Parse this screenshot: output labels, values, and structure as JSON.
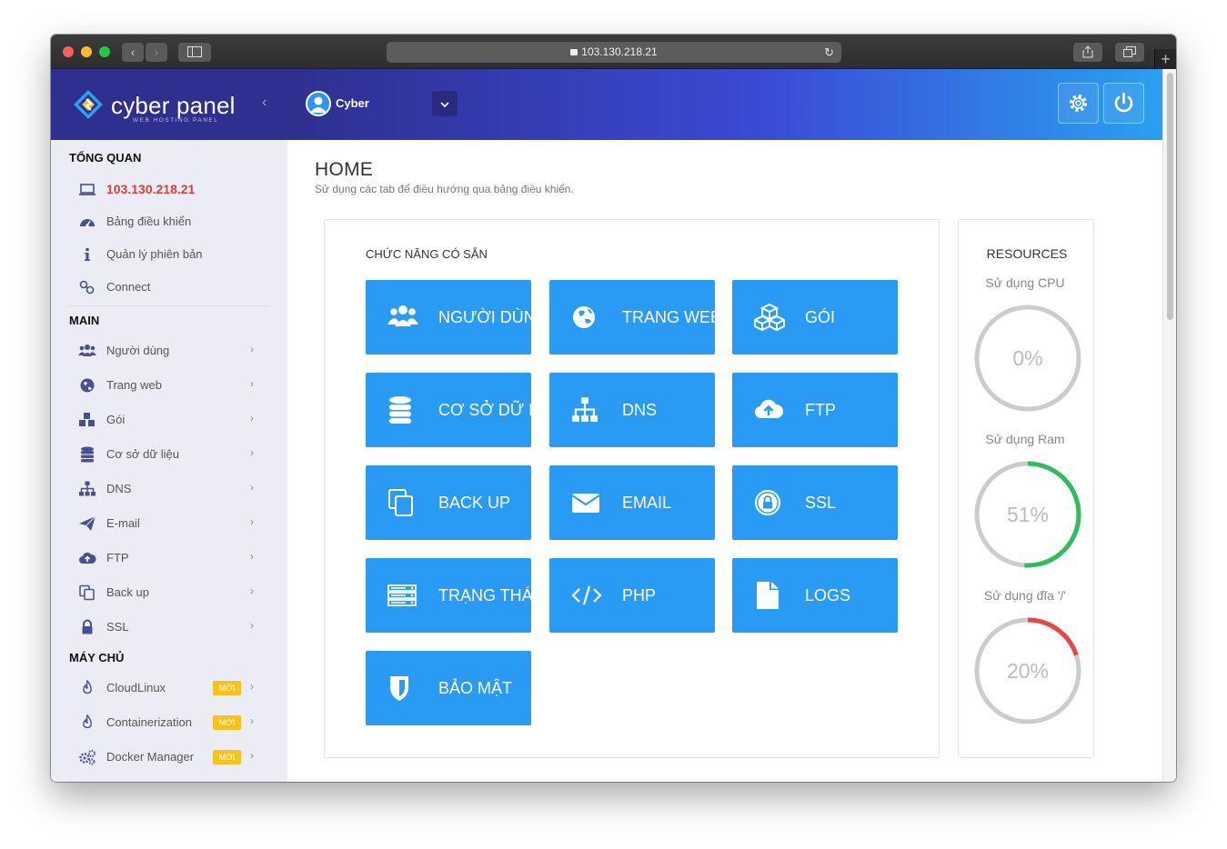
{
  "browser": {
    "url": "103.130.218.21"
  },
  "sidebar": {
    "brand": "cyber panel",
    "brand_sub": "WEB HOSTING PANEL",
    "sections": {
      "overview": "TỔNG QUAN",
      "main": "MAIN",
      "server": "MÁY CHỦ"
    },
    "overview_items": [
      {
        "label": "103.130.218.21",
        "icon": "laptop-icon"
      },
      {
        "label": "Bảng điều khiển",
        "icon": "dashboard-icon"
      },
      {
        "label": "Quản lý phiên bản",
        "icon": "info-icon"
      },
      {
        "label": "Connect",
        "icon": "link-icon"
      }
    ],
    "main_items": [
      {
        "label": "Người dùng",
        "icon": "users-icon"
      },
      {
        "label": "Trang web",
        "icon": "globe-icon"
      },
      {
        "label": "Gói",
        "icon": "cubes-icon"
      },
      {
        "label": "Cơ sở dữ liệu",
        "icon": "database-icon"
      },
      {
        "label": "DNS",
        "icon": "sitemap-icon"
      },
      {
        "label": "E-mail",
        "icon": "paper-plane-icon"
      },
      {
        "label": "FTP",
        "icon": "cloud-upload-icon"
      },
      {
        "label": "Back up",
        "icon": "copy-icon"
      },
      {
        "label": "SSL",
        "icon": "lock-icon"
      }
    ],
    "server_items": [
      {
        "label": "CloudLinux",
        "icon": "fire-icon",
        "badge": "MỚI"
      },
      {
        "label": "Containerization",
        "icon": "fire-icon",
        "badge": "MỚI"
      },
      {
        "label": "Docker Manager",
        "icon": "cogs-icon",
        "badge": "MỚI"
      }
    ]
  },
  "header": {
    "user": "Cyber"
  },
  "page": {
    "title": "HOME",
    "subtitle": "Sử dụng các tab để điều hướng qua bảng điều khiển."
  },
  "features": {
    "title": "CHỨC NĂNG CÓ SẴN",
    "tiles": [
      {
        "label": "NGƯỜI DÙNG",
        "icon": "users-icon"
      },
      {
        "label": "TRANG WEB",
        "icon": "globe-icon"
      },
      {
        "label": "GÓI",
        "icon": "cubes-icon"
      },
      {
        "label": "CƠ SỞ DỮ LIỆU",
        "icon": "database-icon"
      },
      {
        "label": "DNS",
        "icon": "sitemap-icon"
      },
      {
        "label": "FTP",
        "icon": "cloud-upload-icon"
      },
      {
        "label": "BACK UP",
        "icon": "copy-icon"
      },
      {
        "label": "EMAIL",
        "icon": "envelope-icon"
      },
      {
        "label": "SSL",
        "icon": "lock-circle-icon"
      },
      {
        "label": "TRẠNG THÁI",
        "icon": "server-icon"
      },
      {
        "label": "PHP",
        "icon": "code-icon"
      },
      {
        "label": "LOGS",
        "icon": "file-icon"
      },
      {
        "label": "BẢO MẬT",
        "icon": "shield-icon"
      }
    ]
  },
  "resources": {
    "title": "RESOURCES",
    "gauges": [
      {
        "label": "Sử dụng CPU",
        "value": 0,
        "text": "0%",
        "color": "#c8c8c8"
      },
      {
        "label": "Sử dụng Ram",
        "value": 51,
        "text": "51%",
        "color": "#2dbd5a"
      },
      {
        "label": "Sử dụng đĩa '/'",
        "value": 20,
        "text": "20%",
        "color": "#e8454b"
      }
    ]
  },
  "colors": {
    "tile": "#2a9bf4",
    "brand": "#2f2f8f",
    "ip_text": "#d64045",
    "badge": "#f6c21d"
  }
}
